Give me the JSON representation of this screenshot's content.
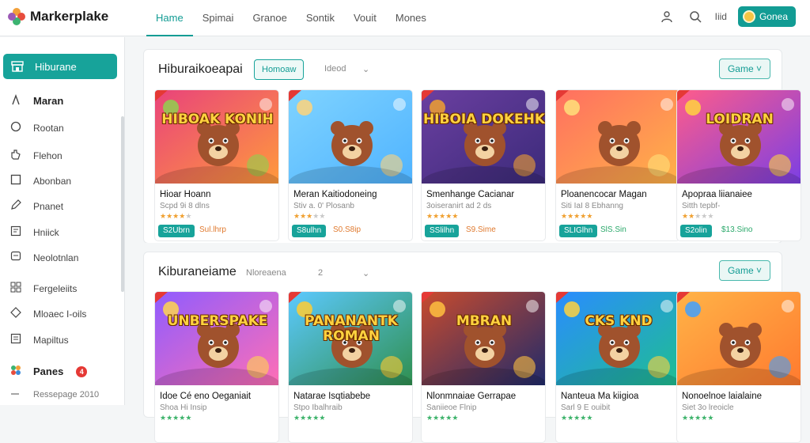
{
  "app": {
    "name": "Markerplake"
  },
  "nav": {
    "tabs": [
      "Hame",
      "Spimai",
      "Granoe",
      "Sontik",
      "Vouit",
      "Mones"
    ],
    "active": 0
  },
  "top": {
    "text": "Iiid",
    "button_label": "Gonea"
  },
  "sidebar": {
    "active_label": "Hiburane",
    "items": [
      {
        "label": "Maran",
        "icon": "arrow-up-icon",
        "bold": true
      },
      {
        "label": "Rootan",
        "icon": "circle-icon"
      },
      {
        "label": "Flehon",
        "icon": "hand-icon"
      },
      {
        "label": "Abonban",
        "icon": "square-icon"
      },
      {
        "label": "Pnanet",
        "icon": "pencil-icon"
      },
      {
        "label": "Hniick",
        "icon": "frame-icon"
      },
      {
        "label": "Neolotnlan",
        "icon": "chat-icon"
      },
      {
        "label": "Fergeleiits",
        "icon": "grid-icon"
      },
      {
        "label": "Mloaec I-oils",
        "icon": "diamond-icon"
      },
      {
        "label": "Mapiltus",
        "icon": "list-icon"
      },
      {
        "label": "Panes",
        "icon": "puzzle-icon",
        "bold": true,
        "badge": "4"
      },
      {
        "label": "Ressepage 2010",
        "icon": "dash-icon"
      }
    ]
  },
  "sections": [
    {
      "title": "Hiburaikoeapai",
      "filter_outlined": "Homoaw",
      "filter_plain": "Ideod",
      "sort_label": "Game",
      "cards": [
        {
          "title": "Hioar Hoann",
          "sub": "Scpd 9i 8 dlns",
          "stars_on": 4,
          "stars_off": 1,
          "star_style": "orange",
          "price": "S2Ubrn",
          "alt": "Sul.lhrp",
          "alt_style": "orange",
          "art": "HIBOAK KONIH"
        },
        {
          "title": "Meran Kaitiodoneing",
          "sub": "Stiv a. 0' Plosanb",
          "stars_on": 3,
          "stars_off": 2,
          "star_style": "orange",
          "price": "S8ulhn",
          "alt": "S0.S8ip",
          "alt_style": "orange",
          "art": ""
        },
        {
          "title": "Smenhange Cacianar",
          "sub": "3oiseranirt ad 2 ds",
          "stars_on": 5,
          "stars_off": 0,
          "star_style": "orange",
          "price": "SSlilhn",
          "alt": "S9.Sime",
          "alt_style": "orange",
          "art": "HIBOIA DOKEHK"
        },
        {
          "title": "Ploanencocar Magan",
          "sub": "Siti IaI 8 Ebhanng",
          "stars_on": 5,
          "stars_off": 0,
          "star_style": "orange",
          "price": "SLIGlhn",
          "alt": "SlS.Sin",
          "alt_style": "green",
          "art": ""
        },
        {
          "title": "Apopraa liianaiee",
          "sub": "Sitth tepbf-",
          "stars_on": 2,
          "stars_off": 3,
          "star_style": "orange",
          "price": "S2olin",
          "alt": "$13.Sino",
          "alt_style": "green",
          "art": "LOIDRAN"
        }
      ]
    },
    {
      "title": "Kiburaneiame",
      "filter_outlined": "",
      "filter_plain": "Nloreaena",
      "filter_number": "2",
      "sort_label": "Game",
      "cards": [
        {
          "title": "Idoe Cé eno Oeganiait",
          "sub": "Shoa Hi Insip",
          "stars_on": 5,
          "stars_off": 0,
          "star_style": "green",
          "art": "UNBERSPAKE"
        },
        {
          "title": "Natarae Isqtiabebe",
          "sub": "Stpo Ibalhraib",
          "stars_on": 5,
          "stars_off": 0,
          "star_style": "green",
          "art": "PANANANTK ROMAN"
        },
        {
          "title": "Nlonmnaiae Gerrapae",
          "sub": "Saniieoe Flnip",
          "stars_on": 5,
          "stars_off": 0,
          "star_style": "green",
          "art": "MBRAN"
        },
        {
          "title": "Nanteua Ma kiigioa",
          "sub": "Sarl 9 E ouibit",
          "stars_on": 5,
          "stars_off": 0,
          "star_style": "green",
          "art": "CKS KND"
        },
        {
          "title": "Nonoelnoe laialaine",
          "sub": "Siet 3o lreoicle",
          "stars_on": 5,
          "stars_off": 0,
          "star_style": "green",
          "art": ""
        }
      ]
    }
  ],
  "colors": {
    "accent": "#17a39a",
    "star": "#f0a030",
    "star_green": "#3db36b",
    "badge": "#e53935"
  }
}
